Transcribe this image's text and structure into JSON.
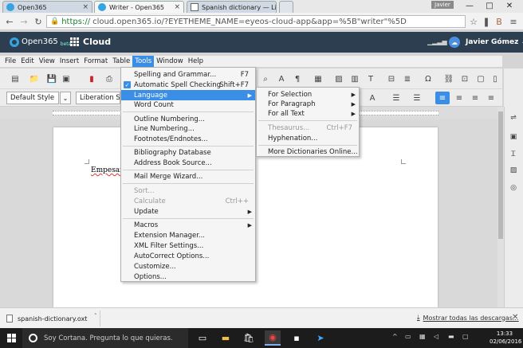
{
  "browser": {
    "tabs": [
      {
        "title": "Open365",
        "active": false
      },
      {
        "title": "Writer - Open365",
        "active": true
      },
      {
        "title": "Spanish dictionary — Libr",
        "active": false
      }
    ],
    "user_badge": "Javier",
    "window_controls": [
      "—",
      "□",
      "✕"
    ],
    "url_scheme": "https://",
    "url_rest": "cloud.open365.io/?EYETHEME_NAME=eyeos-cloud-app&app=%5B\"writer\"%5D"
  },
  "eyeos": {
    "logo_text": "Open365",
    "logo_sub": "beta",
    "apps_label": "Cloud",
    "user_name": "Javier Gómez ⌄"
  },
  "menubar": {
    "items": [
      "File",
      "Edit",
      "View",
      "Insert",
      "Format",
      "Table",
      "Tools",
      "Window",
      "Help"
    ],
    "open_item": "Tools"
  },
  "toolbar": {
    "paragraph_style": "Default Style",
    "font_name": "Liberation Se"
  },
  "document": {
    "text": "Empesan"
  },
  "tools_menu": {
    "items": [
      {
        "label": "Spelling and Grammar...",
        "shortcut": "F7"
      },
      {
        "label": "Automatic Spell Checking",
        "shortcut": "Shift+F7",
        "checked": true
      },
      {
        "label": "Language",
        "submenu": true,
        "highlighted": true
      },
      {
        "label": "Word Count"
      },
      {
        "label": "Outline Numbering..."
      },
      {
        "label": "Line Numbering..."
      },
      {
        "label": "Footnotes/Endnotes..."
      },
      {
        "label": "Bibliography Database"
      },
      {
        "label": "Address Book Source..."
      },
      {
        "label": "Mail Merge Wizard..."
      },
      {
        "label": "Sort...",
        "disabled": true
      },
      {
        "label": "Calculate",
        "shortcut": "Ctrl++",
        "disabled": true
      },
      {
        "label": "Update",
        "submenu": true
      },
      {
        "label": "Macros",
        "submenu": true
      },
      {
        "label": "Extension Manager..."
      },
      {
        "label": "XML Filter Settings..."
      },
      {
        "label": "AutoCorrect Options..."
      },
      {
        "label": "Customize..."
      },
      {
        "label": "Options..."
      }
    ]
  },
  "language_menu": {
    "items": [
      {
        "label": "For Selection",
        "submenu": true
      },
      {
        "label": "For Paragraph",
        "submenu": true
      },
      {
        "label": "For all Text",
        "submenu": true
      },
      {
        "label": "Thesaurus...",
        "shortcut": "Ctrl+F7",
        "disabled": true
      },
      {
        "label": "Hyphenation..."
      },
      {
        "label": "More Dictionaries Online..."
      }
    ]
  },
  "downloads": {
    "file_name": "spanish-dictionary.oxt",
    "show_all": "Mostrar todas las descargas...",
    "close": "✕"
  },
  "taskbar": {
    "search_placeholder": "Soy Cortana. Pregunta lo que quieras.",
    "time": "13:33",
    "date": "02/06/2016"
  },
  "colors": {
    "highlight": "#3a8ee6",
    "eyeos_header": "#2c3e50",
    "taskbar": "#1c1c1c"
  }
}
